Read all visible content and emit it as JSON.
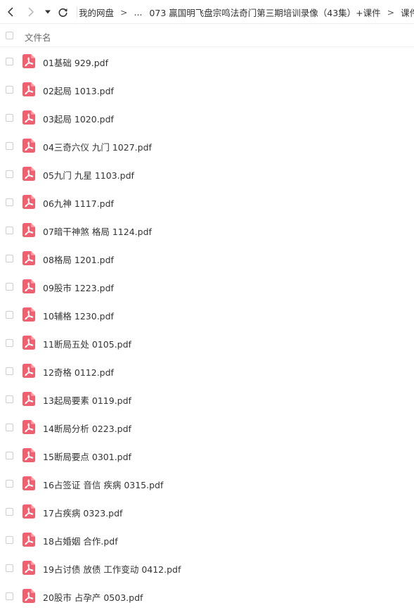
{
  "toolbar": {
    "back_icon": "chevron-left",
    "forward_icon": "chevron-right",
    "history_icon": "caret-down",
    "refresh_icon": "refresh"
  },
  "breadcrumb": {
    "root": "我的网盘",
    "ellipsis": "...",
    "folder": "073 贏国明飞盘宗鸣法奇门第三期培训录像（43集）+课件",
    "subfolder": "课件",
    "separator": ">"
  },
  "list_header": {
    "name_column": "文件名"
  },
  "file_type_icon": "pdf-file",
  "colors": {
    "pdf_icon": "#f0606e",
    "text": "#333333",
    "border": "#cfcfcf"
  },
  "files": [
    {
      "name": "01基础 929.pdf"
    },
    {
      "name": "02起局 1013.pdf"
    },
    {
      "name": "03起局 1020.pdf"
    },
    {
      "name": "04三奇六仪 九门 1027.pdf"
    },
    {
      "name": "05九门 九星 1103.pdf"
    },
    {
      "name": "06九神 1117.pdf"
    },
    {
      "name": "07暗干神煞 格局 1124.pdf"
    },
    {
      "name": "08格局 1201.pdf"
    },
    {
      "name": "09股市 1223.pdf"
    },
    {
      "name": "10辅格 1230.pdf"
    },
    {
      "name": "11断局五处 0105.pdf"
    },
    {
      "name": "12奇格 0112.pdf"
    },
    {
      "name": "13起局要素 0119.pdf"
    },
    {
      "name": "14断局分析 0223.pdf"
    },
    {
      "name": "15断局要点 0301.pdf"
    },
    {
      "name": "16占签证 音信 疾病 0315.pdf"
    },
    {
      "name": "17占疾病 0323.pdf"
    },
    {
      "name": "18占婚姻 合作.pdf"
    },
    {
      "name": "19占讨债 放债 工作变动 0412.pdf"
    },
    {
      "name": "20股市 占孕产 0503.pdf"
    }
  ]
}
